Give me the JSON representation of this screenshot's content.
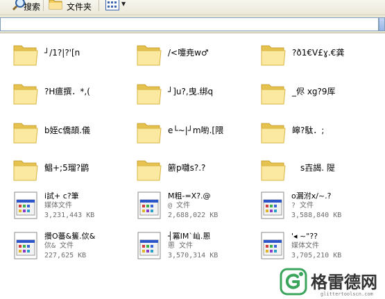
{
  "toolbar": {
    "search_label": "搜索",
    "folders_label": "文件夹"
  },
  "folders": [
    {
      "name": "┘/1?|?'[n"
    },
    {
      "name": "/<嚏尭w♂"
    },
    {
      "name": "?ð1€V£ɣ.€龚"
    },
    {
      "name": "?H癔撰．*,("
    },
    {
      "name": "┘]u?,曳.绑q"
    },
    {
      "name": "_侭  xg?9厍"
    },
    {
      "name": "b姪c僑頡.儀"
    },
    {
      "name": "e└~|┘m喲.[隈"
    },
    {
      "name": "皞?駄．;"
    },
    {
      "name": "鲳+;5瑠?鹠"
    },
    {
      "name": "簖p囃s?.?"
    },
    {
      "name": "s壵謁. 隄"
    }
  ],
  "files": [
    {
      "name": "i試+  c?筆",
      "type": "媒体文件",
      "size": "3,231,443 KB"
    },
    {
      "name": "M粗-=X?.@",
      "type": "@  文件",
      "size": "2,688,022 KB"
    },
    {
      "name": "o漏泭x/~.?",
      "type": "?  文件",
      "size": "3,588,840 KB"
    },
    {
      "name": "攢O蕃&篗.佽&",
      "type": "佽& 文件",
      "size": "227,625 KB"
    },
    {
      "name": "┤冪IM`屾.慁",
      "type": "慁 文件",
      "size": "3,570,314 KB"
    },
    {
      "name": "'◂   ~\"??",
      "type": "媒体文件",
      "size": "3,705,210 KB"
    }
  ],
  "watermark": {
    "title": "格雷德网",
    "url": "glittertoolscn.com"
  },
  "colors": {
    "folder_light": "#fbe9a1",
    "folder_dark": "#e6c24f",
    "toolbar_bg": "#ece9d8",
    "address_border": "#7f9db9",
    "watermark_green": "#3aa55b"
  }
}
